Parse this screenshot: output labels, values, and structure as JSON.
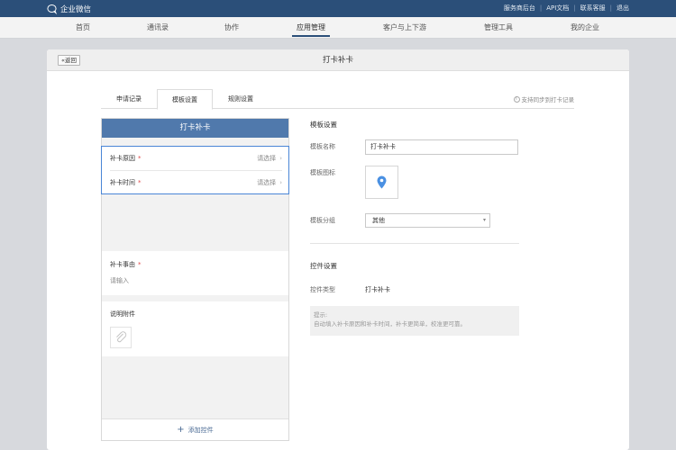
{
  "topbar": {
    "app_name": "企业微信",
    "links": [
      "服务商后台",
      "API文档",
      "联系客服",
      "退出"
    ]
  },
  "nav": {
    "items": [
      "首页",
      "通讯录",
      "协作",
      "应用管理",
      "客户与上下游",
      "管理工具",
      "我的企业"
    ],
    "active": "应用管理"
  },
  "panel": {
    "back_label": "«返回",
    "title": "打卡补卡"
  },
  "tabs": {
    "items": [
      "申请记录",
      "模板设置",
      "规则设置"
    ],
    "active": "模板设置",
    "sync_text": "支持同步到打卡记录"
  },
  "preview": {
    "title": "打卡补卡",
    "rows": [
      {
        "label": "补卡原因",
        "placeholder": "请选择"
      },
      {
        "label": "补卡时间",
        "placeholder": "请选择"
      }
    ],
    "reason_label": "补卡事由",
    "reason_placeholder": "请输入",
    "attach_label": "说明附件",
    "add_control": "添加控件"
  },
  "template_settings": {
    "section_title": "模板设置",
    "name_label": "模板名称",
    "name_value": "打卡补卡",
    "icon_label": "模板图标",
    "icon": "location-pin-icon",
    "group_label": "模板分组",
    "group_value": "其他"
  },
  "control_settings": {
    "section_title": "控件设置",
    "type_label": "控件类型",
    "type_value": "打卡补卡",
    "hint_title": "提示:",
    "hint_text": "自动填入补卡原因和补卡时间，补卡更简单，校准更可靠。"
  },
  "colors": {
    "topbar": "#2b4f79",
    "preview_header": "#5079ac",
    "selection_border": "#4a86d6",
    "pin": "#4a90e2",
    "required": "#e04a4a"
  }
}
